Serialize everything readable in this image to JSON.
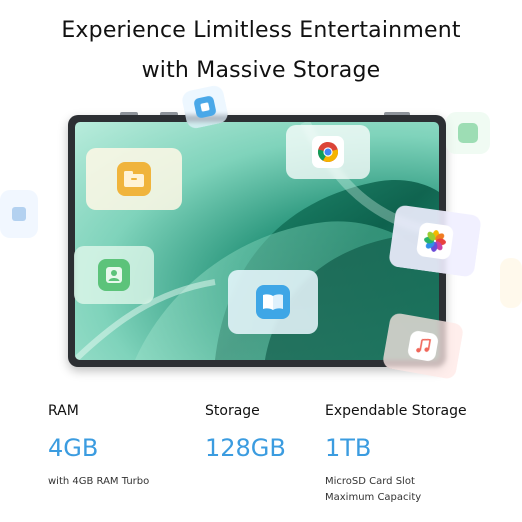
{
  "headline": {
    "line1": "Experience Limitless Entertainment",
    "line2": "with Massive Storage"
  },
  "icons": {
    "folder": "folder-icon",
    "chrome": "chrome-icon",
    "contacts": "contacts-icon",
    "books": "books-icon",
    "photos": "photos-icon",
    "music": "music-icon",
    "files": "files-icon",
    "gallery": "gallery-icon"
  },
  "colors": {
    "accent": "#3b9ce0",
    "text": "#111111"
  },
  "specs": [
    {
      "label": "RAM",
      "value": "4GB",
      "notes": [
        "with 4GB RAM Turbo"
      ]
    },
    {
      "label": "Storage",
      "value": "128GB",
      "notes": []
    },
    {
      "label": "Expendable Storage",
      "value": "1TB",
      "notes": [
        "MicroSD Card Slot",
        "Maximum Capacity"
      ]
    }
  ]
}
